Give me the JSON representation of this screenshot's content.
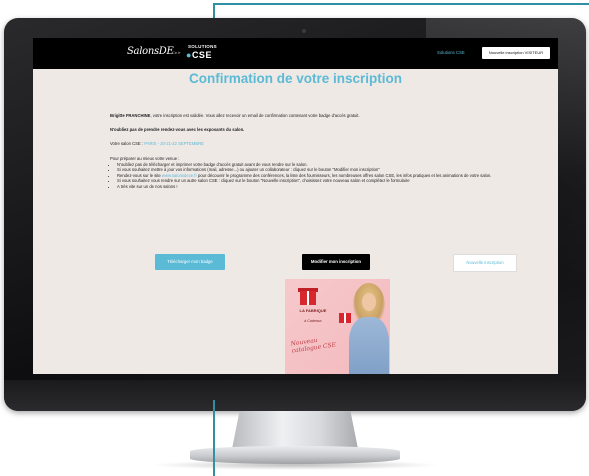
{
  "header": {
    "logo_script": "SalonsDE",
    "logo_small": "Ce.fr",
    "logo_solutions": "SOLUTIONS",
    "logo_cse": "CSE",
    "nav_link": "Solutions CSE",
    "nav_button": "Nouvelle inscription VISITEUR"
  },
  "page": {
    "title": "Confirmation de votre inscription",
    "greeting_name": "Brigitte FRANCHINE",
    "greeting_rest": ", votre inscription est validée. Vous allez recevoir un email de confirmation contenant votre badge d'accès gratuit.",
    "reminder": "N'oubliez pas de prendre rendez-vous avec les exposants du salon.",
    "salon_label": "Votre salon CSE : ",
    "salon_value": "PARIS - 20-21-22 SEPTEMBRE",
    "prep_title": "Pour préparer au mieux votre venue :",
    "prep_items": [
      "N'oubliez pas de télécharger et imprimer votre badge d'accès gratuit avant de vous rendre sur le salon.",
      "Si vous souhaitez mettre à jour vos informations (mail, adresse...) ou ajouter un collaborateur : cliquez sur le bouton \"Modifier mon inscription\"",
      "Si vous souhaitez vous rendre sur un autre salon CSE : cliquez sur le bouton \"Nouvelle inscription\", choisissez votre nouveau salon et complétez le formulaire",
      "A très vite sur un de nos salons !"
    ],
    "prep_item3_before": "Rendez-vous sur le site ",
    "prep_item3_link": "www.salonsdece.fr",
    "prep_item3_after": " pour découvrir le programme des conférences, la liste des fournisseurs, les nombreuses offres salon CSE, les infos pratiques et les animations de votre salon."
  },
  "buttons": {
    "download": "Télécharger mon badge",
    "modify": "Modifier mon inscription",
    "new": "Nouvelle inscription"
  },
  "promo": {
    "brand": "LA FABRIQUE",
    "sub": "à Cadeaux",
    "script": "Nouveau catalogue CSE"
  },
  "colors": {
    "accent": "#5bbad5",
    "header_bg": "#000000",
    "page_bg": "#efe9e6",
    "deco_line": "#2f8fa3"
  }
}
